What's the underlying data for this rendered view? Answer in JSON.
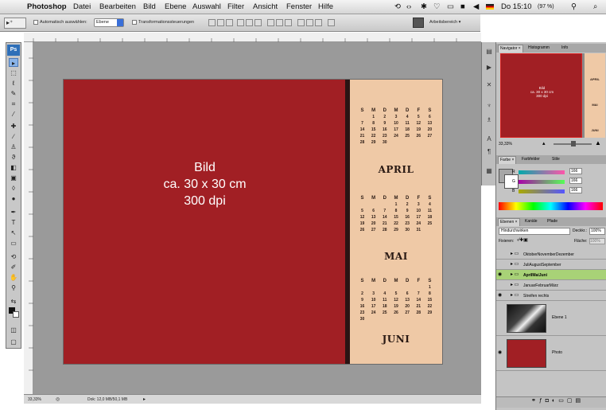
{
  "menubar": {
    "app": "Photoshop",
    "items": [
      "Datei",
      "Bearbeiten",
      "Bild",
      "Ebene",
      "Auswahl",
      "Filter",
      "Ansicht",
      "Fenster",
      "Hilfe"
    ],
    "clock": "Do 15:10",
    "battery": "(97 %)"
  },
  "options": {
    "auto_select": "Automatisch auswählen:",
    "auto_select_value": "Ebene",
    "transform_controls": "Transformationssteuerungen",
    "workspace": "Arbeitsbereich ▾"
  },
  "tools": {
    "logo": "Ps",
    "icons": [
      "move-tool-icon",
      "marquee-tool-icon",
      "lasso-tool-icon",
      "wand-tool-icon",
      "crop-tool-icon",
      "eyedropper-tool-icon",
      "healing-tool-icon",
      "brush-tool-icon",
      "stamp-tool-icon",
      "history-brush-icon",
      "eraser-tool-icon",
      "gradient-tool-icon",
      "blur-tool-icon",
      "dodge-tool-icon",
      "pen-tool-icon",
      "type-tool-icon",
      "path-select-tool-icon",
      "shape-tool-icon",
      "3d-tool-icon",
      "hand-tool-icon",
      "zoom-tool-icon"
    ]
  },
  "document": {
    "photo_lines": [
      "Bild",
      "ca. 30 x 30 cm",
      "300 dpi"
    ],
    "calendars": [
      {
        "month": "APRIL",
        "weekdays": [
          "S",
          "M",
          "D",
          "M",
          "D",
          "F",
          "S"
        ],
        "rows": [
          [
            "",
            "1",
            "2",
            "3",
            "4",
            "5",
            "6"
          ],
          [
            "7",
            "8",
            "9",
            "10",
            "11",
            "12",
            "13"
          ],
          [
            "14",
            "15",
            "16",
            "17",
            "18",
            "19",
            "20"
          ],
          [
            "21",
            "22",
            "23",
            "24",
            "25",
            "26",
            "27"
          ],
          [
            "28",
            "29",
            "30",
            "",
            "",
            "",
            ""
          ]
        ]
      },
      {
        "month": "MAI",
        "weekdays": [
          "S",
          "M",
          "D",
          "M",
          "D",
          "F",
          "S"
        ],
        "rows": [
          [
            "",
            "",
            "",
            "1",
            "2",
            "3",
            "4"
          ],
          [
            "5",
            "6",
            "7",
            "8",
            "9",
            "10",
            "11"
          ],
          [
            "12",
            "13",
            "14",
            "15",
            "16",
            "17",
            "18"
          ],
          [
            "19",
            "20",
            "21",
            "22",
            "23",
            "24",
            "25"
          ],
          [
            "26",
            "27",
            "28",
            "29",
            "30",
            "31",
            ""
          ]
        ]
      },
      {
        "month": "JUNI",
        "weekdays": [
          "S",
          "M",
          "D",
          "M",
          "D",
          "F",
          "S"
        ],
        "rows": [
          [
            "",
            "",
            "",
            "",
            "",
            "",
            "1"
          ],
          [
            "2",
            "3",
            "4",
            "5",
            "6",
            "7",
            "8"
          ],
          [
            "9",
            "10",
            "11",
            "12",
            "13",
            "14",
            "15"
          ],
          [
            "16",
            "17",
            "18",
            "19",
            "20",
            "21",
            "22"
          ],
          [
            "23",
            "24",
            "25",
            "26",
            "27",
            "28",
            "29"
          ],
          [
            "30",
            "",
            "",
            "",
            "",
            "",
            ""
          ]
        ]
      }
    ]
  },
  "status": {
    "zoom": "33,33%",
    "doc_size": "Dok: 12,0 MB/50,1 MB"
  },
  "navigator": {
    "tabs": [
      "Navigator ×",
      "Histogramm",
      "Info"
    ],
    "zoom": "33,33%",
    "thumb_lines": [
      "Bild",
      "ca. 30 x 30 cm",
      "300 dpi"
    ],
    "thumb_months": [
      "APRIL",
      "MAI",
      "JUNI"
    ]
  },
  "color": {
    "tabs": [
      "Farbe ×",
      "Farbfelder",
      "Stile"
    ],
    "channels": [
      {
        "label": "R",
        "value": "166"
      },
      {
        "label": "G",
        "value": "166"
      },
      {
        "label": "B",
        "value": "166"
      }
    ]
  },
  "layers": {
    "tabs": [
      "Ebenen ×",
      "Kanäle",
      "Pfade"
    ],
    "blend_mode": "Hindurchwirken",
    "opacity_label": "Deckkr.:",
    "opacity": "100%",
    "lock_label": "Fixieren:",
    "fill_label": "Fläche:",
    "fill": "100%",
    "groups": [
      "OktoberNovemberDezember",
      "JuliAugustSeptember",
      "AprilMaiJuni",
      "JanuarFebruarMärz",
      "Streifen rechts"
    ],
    "image_layers": [
      "Ebene 1",
      "Photo"
    ]
  }
}
